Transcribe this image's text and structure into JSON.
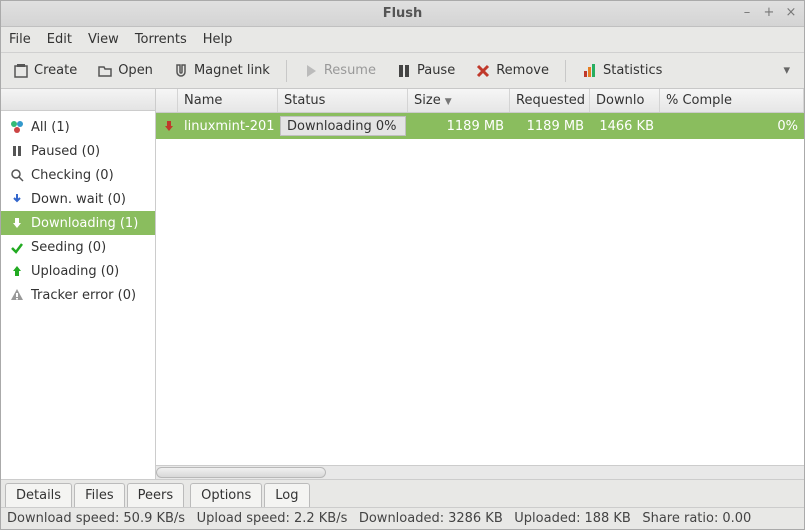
{
  "window": {
    "title": "Flush"
  },
  "menubar": [
    "File",
    "Edit",
    "View",
    "Torrents",
    "Help"
  ],
  "toolbar": {
    "create": "Create",
    "open": "Open",
    "magnet": "Magnet link",
    "resume": "Resume",
    "pause": "Pause",
    "remove": "Remove",
    "statistics": "Statistics"
  },
  "sidebar": {
    "items": [
      {
        "label": "All (1)",
        "icon": "all",
        "selected": false
      },
      {
        "label": "Paused (0)",
        "icon": "paused",
        "selected": false
      },
      {
        "label": "Checking (0)",
        "icon": "checking",
        "selected": false
      },
      {
        "label": "Down. wait (0)",
        "icon": "downwait",
        "selected": false
      },
      {
        "label": "Downloading (1)",
        "icon": "downloading",
        "selected": true
      },
      {
        "label": "Seeding (0)",
        "icon": "seeding",
        "selected": false
      },
      {
        "label": "Uploading (0)",
        "icon": "uploading",
        "selected": false
      },
      {
        "label": "Tracker error (0)",
        "icon": "error",
        "selected": false
      }
    ]
  },
  "columns": {
    "name": "Name",
    "status": "Status",
    "size": "Size",
    "requested": "Requested",
    "download": "Downlo",
    "complete": "% Comple"
  },
  "torrents": [
    {
      "name": "linuxmint-201",
      "status": "Downloading 0%",
      "size": "1189 MB",
      "requested": "1189 MB",
      "download": "1466 KB",
      "complete": "0%"
    }
  ],
  "tabs_left": [
    "Details",
    "Files",
    "Peers"
  ],
  "tabs_right": [
    "Options",
    "Log"
  ],
  "statusbar": {
    "dl_speed_label": "Download speed:",
    "dl_speed": "50.9 KB/s",
    "ul_speed_label": "Upload speed:",
    "ul_speed": "2.2 KB/s",
    "downloaded_label": "Downloaded:",
    "downloaded": "3286 KB",
    "uploaded_label": "Uploaded:",
    "uploaded": "188 KB",
    "ratio_label": "Share ratio:",
    "ratio": "0.00"
  }
}
